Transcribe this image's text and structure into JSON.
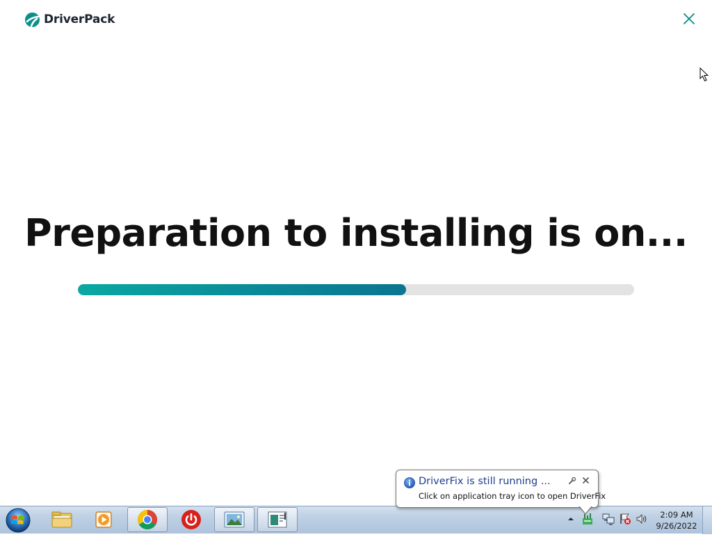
{
  "app": {
    "brand_name": "DriverPack",
    "headline": "Preparation to installing is on...",
    "progress_fraction": 0.59,
    "accent_color": "#0aa8a2"
  },
  "notification": {
    "title": "DriverFix is still running ...",
    "message": "Click on application tray icon to open DriverFix",
    "icon": "info-icon"
  },
  "taskbar": {
    "buttons": [
      {
        "name": "windows-explorer",
        "icon": "folder-icon"
      },
      {
        "name": "media-player",
        "icon": "media-player-icon"
      },
      {
        "name": "google-chrome",
        "icon": "chrome-icon"
      },
      {
        "name": "power-app",
        "icon": "power-icon"
      },
      {
        "name": "image-viewer",
        "icon": "picture-icon"
      },
      {
        "name": "driverpack-window",
        "icon": "window-icon"
      }
    ],
    "tray_icons": [
      "driverfix-icon",
      "network-icon",
      "action-center-icon",
      "volume-icon"
    ],
    "clock": {
      "time": "2:09 AM",
      "date": "9/26/2022"
    }
  }
}
